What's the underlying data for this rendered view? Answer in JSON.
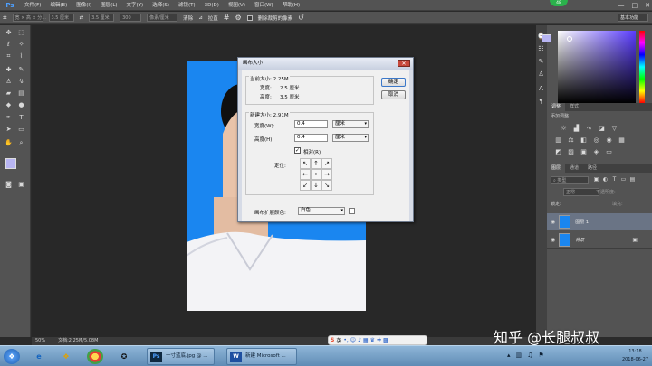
{
  "app": {
    "logo": "Ps",
    "notification_count": "48"
  },
  "menubar": {
    "items": [
      "文件(F)",
      "编辑(E)",
      "图像(I)",
      "图层(L)",
      "文字(Y)",
      "选择(S)",
      "滤镜(T)",
      "3D(D)",
      "视图(V)",
      "窗口(W)",
      "帮助(H)"
    ],
    "window_controls": [
      "—",
      "□",
      "✕"
    ]
  },
  "options_bar": {
    "field1": "宽 × 高 × 分...",
    "field2": "3.5 厘米",
    "field3": "300",
    "field4": "像素/厘米",
    "clear_label": "清除",
    "straighten_label": "拉直",
    "delete_cropped_label": "删除裁剪的像素",
    "workspace": "基本功能"
  },
  "status_bar": {
    "zoom": "50%",
    "doc_info": "文档:2.25M/5.08M"
  },
  "panels": {
    "color_tabs": [
      "颜色",
      "色板"
    ],
    "adjust_tabs": [
      "调整",
      "样式"
    ],
    "adjust_title": "添加调整",
    "layer_tabs": [
      "图层",
      "通道",
      "路径"
    ],
    "kind_label": "类型",
    "blend_mode": "正常",
    "opacity_label": "不透明度:",
    "lock_label": "锁定:",
    "fill_label": "填充:",
    "layers": [
      {
        "name": "图层 1"
      },
      {
        "name": "背景"
      }
    ]
  },
  "dialog": {
    "title": "画布大小",
    "current_size_label": "当前大小: 2.25M",
    "current_width_label": "宽度:",
    "current_width_value": "2.5 厘米",
    "current_height_label": "高度:",
    "current_height_value": "3.5 厘米",
    "new_size_label": "新建大小: 2.91M",
    "width_label": "宽度(W):",
    "width_value": "0.4",
    "width_unit": "厘米",
    "height_label": "高度(H):",
    "height_value": "0.4",
    "height_unit": "厘米",
    "relative_label": "相对(R)",
    "anchor_label": "定位:",
    "extension_color_label": "画布扩展颜色:",
    "extension_color_value": "白色",
    "ok_label": "确定",
    "cancel_label": "取消"
  },
  "taskbar": {
    "ps_window": "一寸蓝底.jpg @ ...",
    "word_window": "新建 Microsoft ...",
    "time": "13:18",
    "date": "2018-06-27"
  },
  "ime": {
    "lang": "英"
  },
  "watermark": "知乎 @长腿叔叔"
}
